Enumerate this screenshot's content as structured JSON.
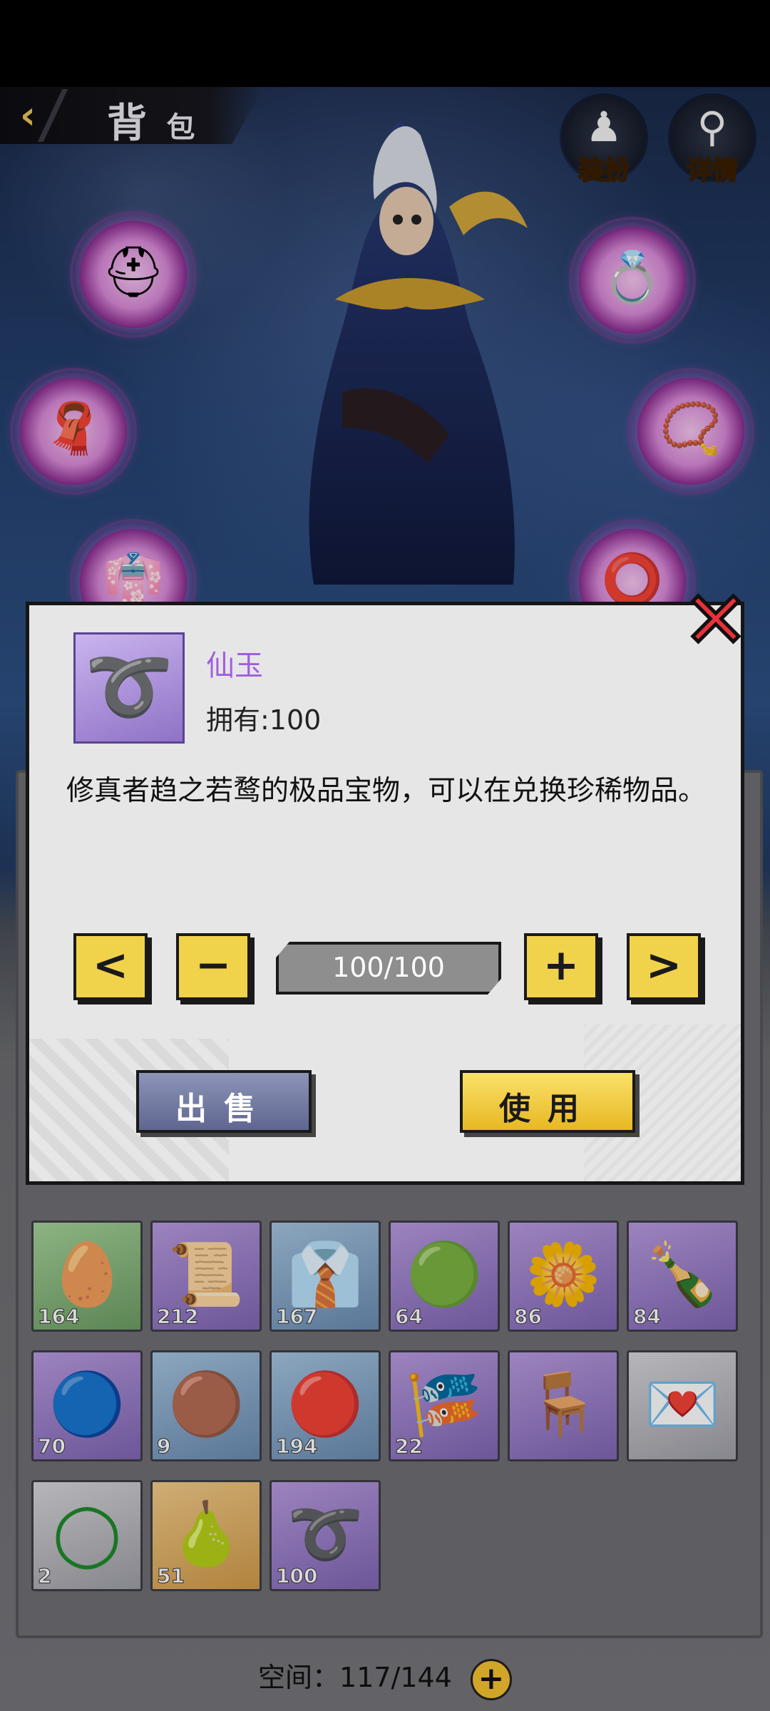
{
  "header": {
    "title_main": "背",
    "title_small": "包",
    "dress_label": "装扮",
    "detail_label": "详情"
  },
  "bag": {
    "items": [
      {
        "count": "164",
        "icon": "egg-icon",
        "rarity": "green"
      },
      {
        "count": "212",
        "icon": "scroll-icon",
        "rarity": "purple"
      },
      {
        "count": "167",
        "icon": "shirt-icon",
        "rarity": "blue"
      },
      {
        "count": "64",
        "icon": "jade-pendant-icon",
        "rarity": "purple"
      },
      {
        "count": "86",
        "icon": "flower-icon",
        "rarity": "purple"
      },
      {
        "count": "84",
        "icon": "wine-bottle-icon",
        "rarity": "purple"
      },
      {
        "count": "70",
        "icon": "blue-orb-icon",
        "rarity": "purple"
      },
      {
        "count": "9",
        "icon": "gold-orb-icon",
        "rarity": "blue"
      },
      {
        "count": "194",
        "icon": "red-orb-icon",
        "rarity": "blue"
      },
      {
        "count": "22",
        "icon": "scroll-ribbon-icon",
        "rarity": "purple"
      },
      {
        "count": "",
        "icon": "table-icon",
        "rarity": "purple"
      },
      {
        "count": "",
        "icon": "letter-icon",
        "rarity": "gray"
      },
      {
        "count": "2",
        "icon": "jade-ring-icon",
        "rarity": "gray"
      },
      {
        "count": "51",
        "icon": "pear-icon",
        "rarity": "gold"
      },
      {
        "count": "100",
        "icon": "xianyu-icon",
        "rarity": "purple"
      }
    ],
    "space_label": "空间：",
    "space_value": "117/144"
  },
  "dialog": {
    "item_name": "仙玉",
    "owned": "拥有:100",
    "description": "修真者趋之若鹜的极品宝物，可以在兑换珍稀物品。",
    "quantity": "100/100",
    "prev_label": "<",
    "minus_label": "−",
    "plus_label": "+",
    "next_label": ">",
    "sell_label": "出售",
    "use_label": "使用",
    "close_label": "✕"
  },
  "colors": {
    "name_purple": "#a15ee0",
    "button_yellow": "#f1d24b",
    "close_red": "#e8313a"
  }
}
